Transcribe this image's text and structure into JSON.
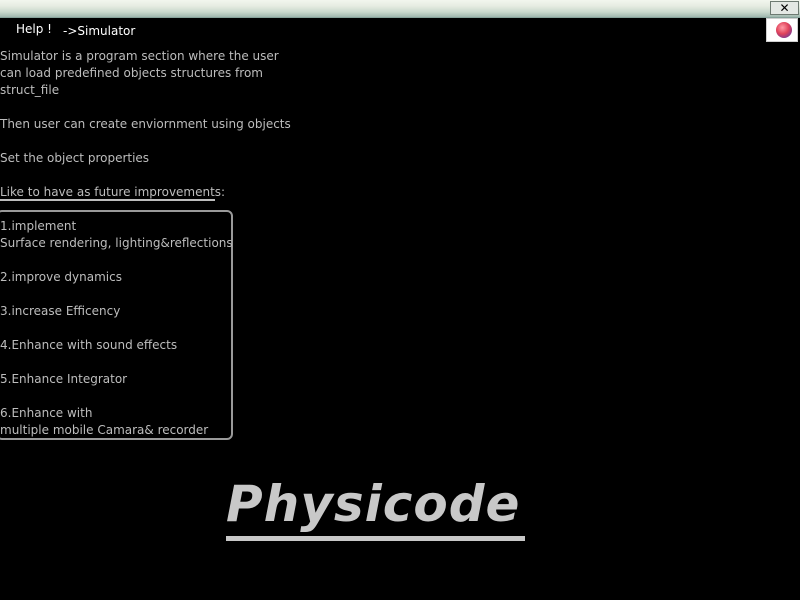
{
  "titlebar": {
    "close_label": "✕"
  },
  "header": {
    "help_label": "Help !",
    "breadcrumb": "->Simulator"
  },
  "avatar": {
    "icon": "colorful-ball-icon"
  },
  "content": {
    "intro_lines": [
      "Simulator is a program section where the user",
      "can load predefined objects structures from",
      "struct_file"
    ],
    "environment": "Then user can create enviornment using objects",
    "properties": "Set the object properties",
    "future_heading": "Like to have as future improvements:",
    "improvements": [
      {
        "line1": "1.implement",
        "line2": "Surface rendering, lighting&reflections"
      },
      {
        "line1": "2.improve dynamics",
        "line2": ""
      },
      {
        "line1": "3.increase Efficency",
        "line2": ""
      },
      {
        "line1": "4.Enhance with sound effects",
        "line2": ""
      },
      {
        "line1": "5.Enhance Integrator",
        "line2": ""
      },
      {
        "line1": "6.Enhance with",
        "line2": "multiple mobile Camara& recorder"
      }
    ]
  },
  "logo": {
    "text": "Physicode"
  },
  "colors": {
    "background": "#000000",
    "text": "#bdbdbd",
    "header_text": "#ffffff",
    "box_border": "#9a9a9a",
    "logo": "#c8c8c8"
  }
}
